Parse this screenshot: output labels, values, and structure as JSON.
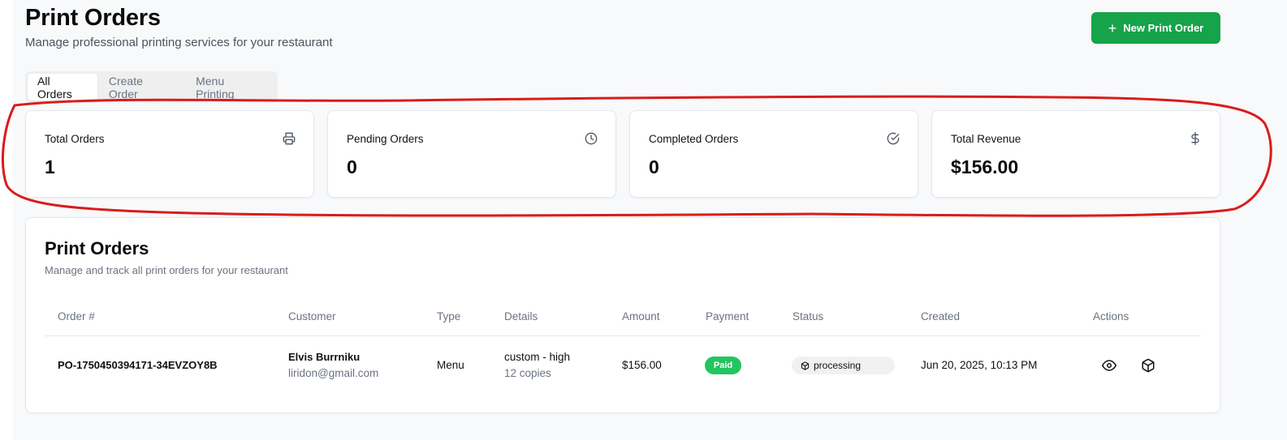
{
  "header": {
    "title": "Print Orders",
    "subtitle": "Manage professional printing services for your restaurant",
    "new_button_label": "New Print Order"
  },
  "tabs": [
    {
      "label": "All Orders",
      "active": true
    },
    {
      "label": "Create Order",
      "active": false
    },
    {
      "label": "Menu Printing",
      "active": false
    }
  ],
  "stats": [
    {
      "label": "Total Orders",
      "value": "1",
      "icon": "printer-icon"
    },
    {
      "label": "Pending Orders",
      "value": "0",
      "icon": "clock-icon"
    },
    {
      "label": "Completed Orders",
      "value": "0",
      "icon": "check-circle-icon"
    },
    {
      "label": "Total Revenue",
      "value": "$156.00",
      "icon": "dollar-icon"
    }
  ],
  "orders": {
    "title": "Print Orders",
    "subtitle": "Manage and track all print orders for your restaurant",
    "columns": [
      "Order #",
      "Customer",
      "Type",
      "Details",
      "Amount",
      "Payment",
      "Status",
      "Created",
      "Actions"
    ],
    "rows": [
      {
        "order_no": "PO-1750450394171-34EVZOY8B",
        "customer_name": "Elvis Burrniku",
        "customer_email": "liridon@gmail.com",
        "type": "Menu",
        "details_main": "custom - high",
        "details_sub": "12 copies",
        "amount": "$156.00",
        "payment": "Paid",
        "status": "processing",
        "created": "Jun 20, 2025, 10:13 PM"
      }
    ]
  },
  "colors": {
    "accent_green": "#16a34a",
    "paid_badge": "#22c55e",
    "annotation_red": "#d91c1c"
  }
}
